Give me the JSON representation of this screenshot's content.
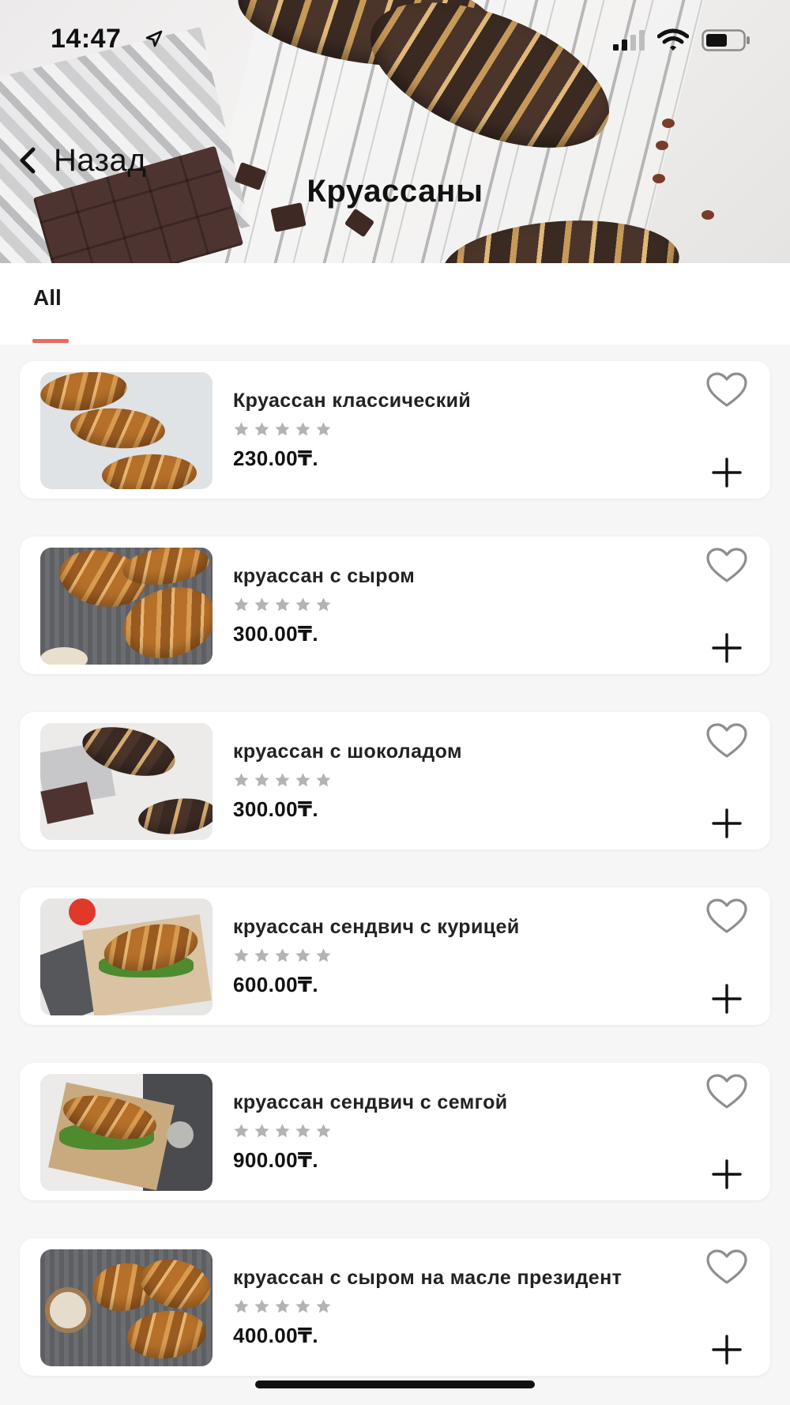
{
  "status_bar": {
    "time": "14:47"
  },
  "header": {
    "back_label": "Назад",
    "title": "Круассаны"
  },
  "tabs": [
    {
      "label": "All",
      "active": true
    }
  ],
  "accent_color": "#e9685c",
  "products": [
    {
      "name": "Круассан классический",
      "price": "230.00₸.",
      "rating": 0
    },
    {
      "name": "круассан с сыром",
      "price": "300.00₸.",
      "rating": 0
    },
    {
      "name": "круассан с шоколадом",
      "price": "300.00₸.",
      "rating": 0
    },
    {
      "name": "круассан сендвич с курицей",
      "price": "600.00₸.",
      "rating": 0
    },
    {
      "name": "круассан сендвич с семгой",
      "price": "900.00₸.",
      "rating": 0
    },
    {
      "name": "круассан с сыром на масле президент",
      "price": "400.00₸.",
      "rating": 0
    }
  ]
}
